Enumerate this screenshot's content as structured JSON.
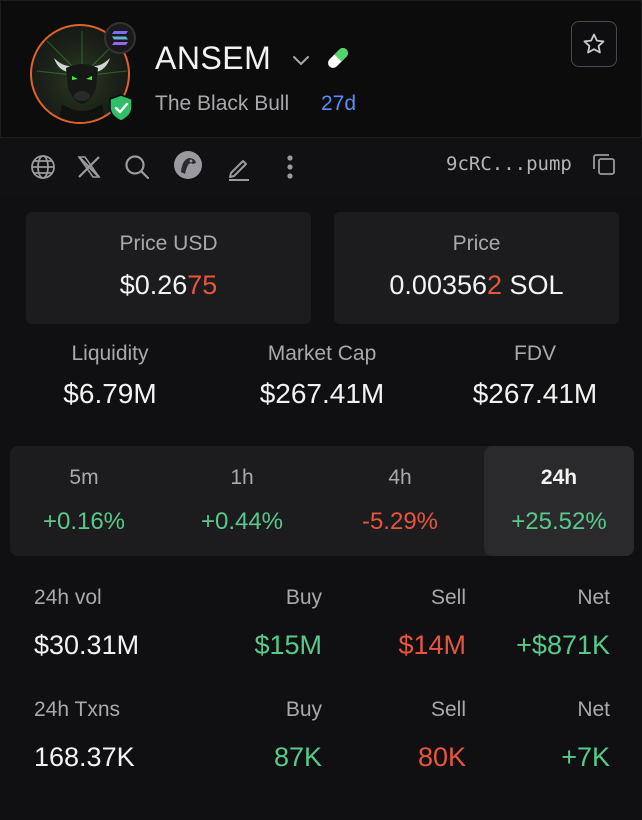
{
  "token": {
    "symbol": "ANSEM",
    "name": "The Black Bull",
    "age": "27d",
    "address": "9cRC...pump"
  },
  "prices": {
    "usd_label": "Price USD",
    "usd_main": "$0.26",
    "usd_tail": "75",
    "native_label": "Price",
    "native_main": "0.00356",
    "native_tail": "2",
    "native_unit": " SOL"
  },
  "stats": [
    {
      "label": "Liquidity",
      "value": "$6.79M"
    },
    {
      "label": "Market Cap",
      "value": "$267.41M"
    },
    {
      "label": "FDV",
      "value": "$267.41M"
    }
  ],
  "timeframes": [
    {
      "label": "5m",
      "value": "+0.16%",
      "trend": "up"
    },
    {
      "label": "1h",
      "value": "+0.44%",
      "trend": "up"
    },
    {
      "label": "4h",
      "value": "-5.29%",
      "trend": "down"
    },
    {
      "label": "24h",
      "value": "+25.52%",
      "trend": "up",
      "active": true
    }
  ],
  "volume": {
    "label": "24h vol",
    "value": "$30.31M",
    "buy_label": "Buy",
    "buy": "$15M",
    "sell_label": "Sell",
    "sell": "$14M",
    "net_label": "Net",
    "net": "+$871K"
  },
  "txns": {
    "label": "24h Txns",
    "value": "168.37K",
    "buy_label": "Buy",
    "buy": "87K",
    "sell_label": "Sell",
    "sell": "80K",
    "net_label": "Net",
    "net": "+7K"
  },
  "colors": {
    "up": "#58c98a",
    "down": "#e8553d",
    "accent": "#5b8df5",
    "avatar_ring": "#e0622a"
  },
  "icons": [
    "globe-icon",
    "x-icon",
    "search-icon",
    "eagle-icon",
    "edit-icon",
    "more-icon",
    "copy-icon",
    "star-icon",
    "solana-icon",
    "verified-shield-icon",
    "pill-icon",
    "chevron-down-icon"
  ]
}
